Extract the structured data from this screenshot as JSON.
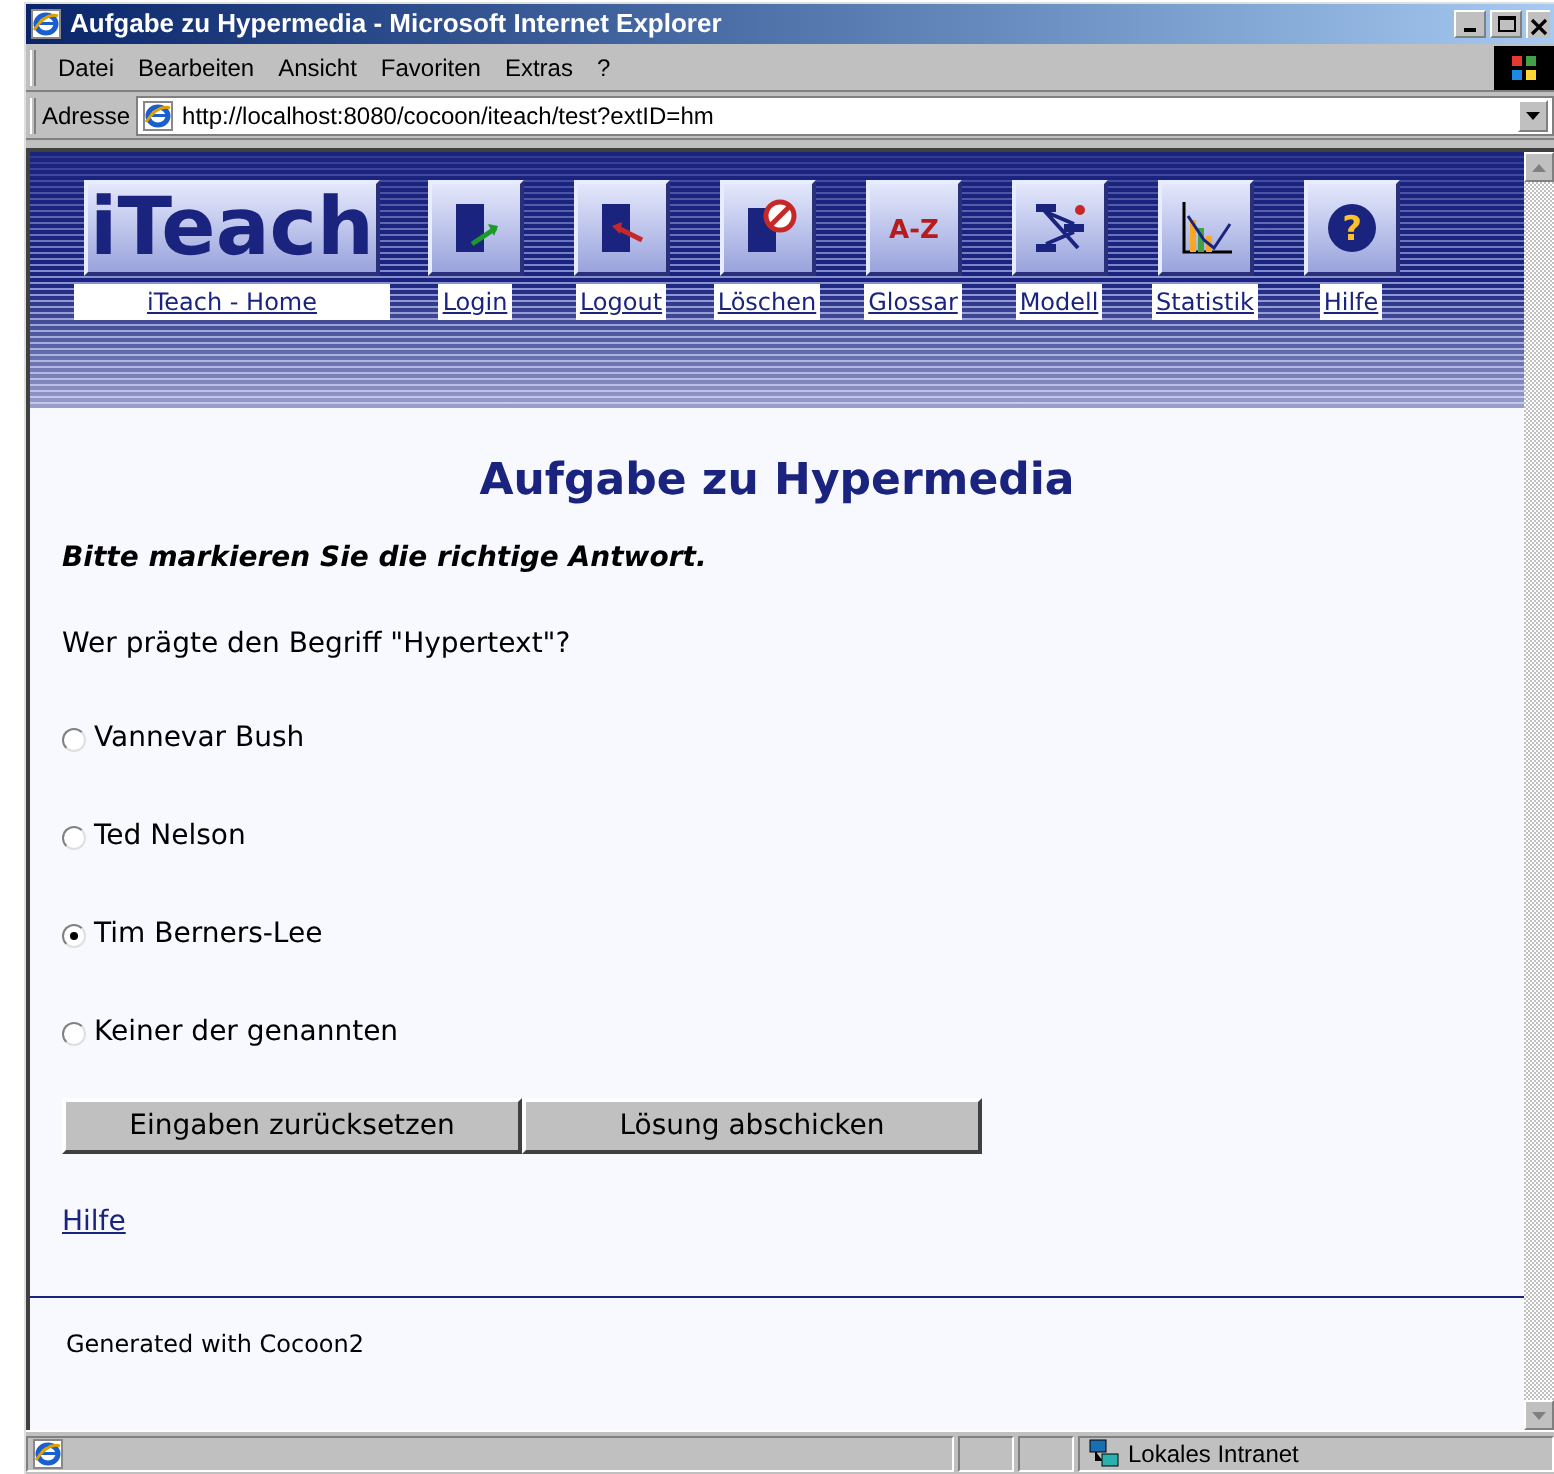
{
  "window": {
    "title": "Aufgabe zu Hypermedia - Microsoft Internet Explorer"
  },
  "menu": [
    "Datei",
    "Bearbeiten",
    "Ansicht",
    "Favoriten",
    "Extras",
    "?"
  ],
  "address": {
    "label": "Adresse",
    "value": "http://localhost:8080/cocoon/iteach/test?extID=hm"
  },
  "banner": {
    "logo": "iTeach",
    "logo_link": "iTeach - Home",
    "nav": [
      {
        "label": "Login",
        "kind": "login"
      },
      {
        "label": "Logout",
        "kind": "logout"
      },
      {
        "label": "Löschen",
        "kind": "delete"
      },
      {
        "label": "Glossar",
        "kind": "glyph",
        "glyph": "A-Z"
      },
      {
        "label": "Modell",
        "kind": "diagram"
      },
      {
        "label": "Statistik",
        "kind": "chart"
      },
      {
        "label": "Hilfe",
        "kind": "help",
        "glyph": "?"
      }
    ]
  },
  "heading": "Aufgabe zu Hypermedia",
  "instruction": "Bitte markieren Sie die richtige Antwort.",
  "question": "Wer prägte den Begriff \"Hypertext\"?",
  "options": [
    {
      "label": "Vannevar Bush",
      "selected": false
    },
    {
      "label": "Ted Nelson",
      "selected": false
    },
    {
      "label": "Tim Berners-Lee",
      "selected": true
    },
    {
      "label": "Keiner der genannten",
      "selected": false
    }
  ],
  "buttons": [
    "Eingaben zurücksetzen",
    "Lösung abschicken"
  ],
  "help_link": "Hilfe",
  "footer": "Generated with Cocoon2",
  "status_bar": {
    "zone": "Lokales Intranet"
  }
}
